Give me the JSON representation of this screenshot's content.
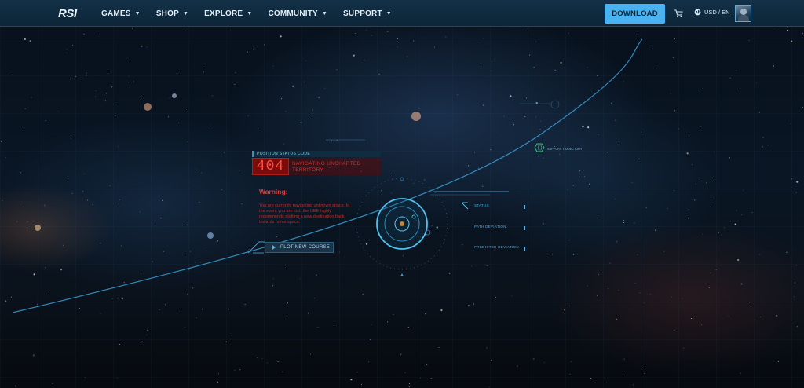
{
  "nav": {
    "logo": "RSI",
    "items": [
      {
        "label": "GAMES"
      },
      {
        "label": "SHOP"
      },
      {
        "label": "EXPLORE"
      },
      {
        "label": "COMMUNITY"
      },
      {
        "label": "SUPPORT"
      }
    ],
    "download_label": "DOWNLOAD",
    "locale": "USD / EN",
    "icons": {
      "cart": "cart-icon",
      "globe": "globe-icon",
      "caret": "chevron-down-icon"
    }
  },
  "hud": {
    "status_label": "POSITION STATUS CODE",
    "code": "404",
    "code_message": "NAVIGATING UNCHARTED TERRITORY",
    "warning_title": "Warning:",
    "warning_text": "You are currently navigating unknown space. In the event you are lost, the UEE highly recommends plotting a new destination back towards home space.",
    "plot_button": "PLOT NEW COURSE",
    "readouts": [
      {
        "label": "STATUS"
      },
      {
        "label": "PATH DEVIATION"
      },
      {
        "label": "PREDICTED DEVIATION"
      }
    ],
    "trajectory_label": "SUPPORT TRAJECTORY"
  },
  "colors": {
    "nav_bg": "#123047",
    "accent": "#4ab3ef",
    "error": "#e83a34",
    "hud_line": "#3a9fd6"
  }
}
